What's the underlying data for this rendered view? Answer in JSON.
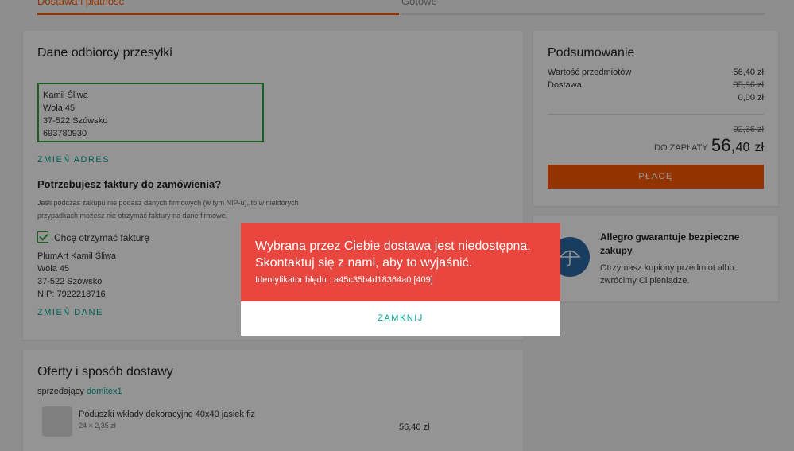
{
  "progress": {
    "step1_label": "Dostawa i płatność",
    "step2_label": "Gotowe"
  },
  "recipient": {
    "heading": "Dane odbiorcy przesyłki",
    "address_lines": [
      "Kamil Śliwa",
      "Wola 45",
      "37-522 Szówsko",
      "693780930"
    ],
    "change_address": "ZMIEŃ ADRES"
  },
  "invoice": {
    "question": "Potrzebujesz faktury do zamówienia?",
    "note": "Jeśli podczas zakupu nie podasz danych firmowych (w tym NIP-u), to w niektórych przypadkach możesz nie otrzymać faktury na dane firmowe.",
    "checkbox_label": "Chcę otrzymać fakturę",
    "checked": true,
    "company_lines": [
      "PlumArt Kamil Śliwa",
      "Wola 45",
      "37-522 Szówsko",
      "NIP: 7922218716"
    ],
    "change_data": "ZMIEŃ DANE"
  },
  "offers": {
    "heading": "Oferty i sposób dostawy",
    "seller_prefix": "sprzedający",
    "seller_name": "domitex1",
    "item_title": "Poduszki wkłady dekoracyjne 40x40 jasiek fiz",
    "item_qty": "24 × 2,35 zł",
    "item_price": "56,40 zł"
  },
  "summary": {
    "heading": "Podsumowanie",
    "items_label": "Wartość przedmiotów",
    "items_value": "56,40 zł",
    "delivery_label": "Dostawa",
    "delivery_old": "35,96 zł",
    "delivery_new": "0,00 zł",
    "total_old": "92,36 zł",
    "to_pay_label": "DO ZAPŁATY",
    "total_main": "56,",
    "total_cents": "40",
    "total_currency": "zł",
    "pay_button": "PŁACĘ"
  },
  "guarantee": {
    "title": "Allegro gwarantuje bezpieczne zakupy",
    "text": "Otrzymasz kupiony przedmiot albo zwrócimy Ci pieniądze."
  },
  "modal": {
    "title": "Wybrana przez Ciebie dostawa jest niedostępna. Skontaktuj się z nami, aby to wyjaśnić.",
    "error_id": "Identyfikator błędu : a45c35b4d18364a0 [409]",
    "close_label": "ZAMKNIJ"
  },
  "colors": {
    "accent": "#ff5a00",
    "link": "#00a790",
    "error": "#e8463e",
    "success": "#2fa33c"
  }
}
